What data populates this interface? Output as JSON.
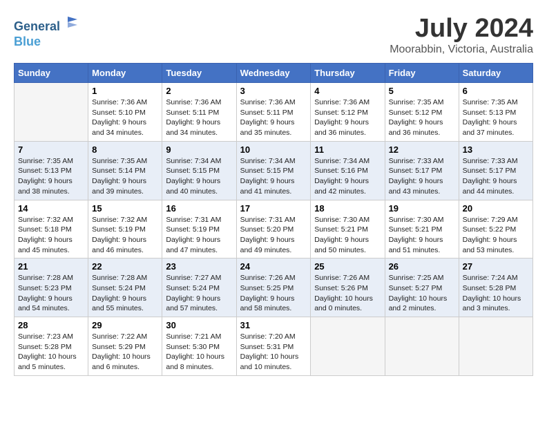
{
  "header": {
    "logo_line1": "General",
    "logo_line2": "Blue",
    "month": "July 2024",
    "location": "Moorabbin, Victoria, Australia"
  },
  "columns": [
    "Sunday",
    "Monday",
    "Tuesday",
    "Wednesday",
    "Thursday",
    "Friday",
    "Saturday"
  ],
  "weeks": [
    [
      {
        "day": "",
        "info": ""
      },
      {
        "day": "1",
        "info": "Sunrise: 7:36 AM\nSunset: 5:10 PM\nDaylight: 9 hours\nand 34 minutes."
      },
      {
        "day": "2",
        "info": "Sunrise: 7:36 AM\nSunset: 5:11 PM\nDaylight: 9 hours\nand 34 minutes."
      },
      {
        "day": "3",
        "info": "Sunrise: 7:36 AM\nSunset: 5:11 PM\nDaylight: 9 hours\nand 35 minutes."
      },
      {
        "day": "4",
        "info": "Sunrise: 7:36 AM\nSunset: 5:12 PM\nDaylight: 9 hours\nand 36 minutes."
      },
      {
        "day": "5",
        "info": "Sunrise: 7:35 AM\nSunset: 5:12 PM\nDaylight: 9 hours\nand 36 minutes."
      },
      {
        "day": "6",
        "info": "Sunrise: 7:35 AM\nSunset: 5:13 PM\nDaylight: 9 hours\nand 37 minutes."
      }
    ],
    [
      {
        "day": "7",
        "info": "Sunrise: 7:35 AM\nSunset: 5:13 PM\nDaylight: 9 hours\nand 38 minutes."
      },
      {
        "day": "8",
        "info": "Sunrise: 7:35 AM\nSunset: 5:14 PM\nDaylight: 9 hours\nand 39 minutes."
      },
      {
        "day": "9",
        "info": "Sunrise: 7:34 AM\nSunset: 5:15 PM\nDaylight: 9 hours\nand 40 minutes."
      },
      {
        "day": "10",
        "info": "Sunrise: 7:34 AM\nSunset: 5:15 PM\nDaylight: 9 hours\nand 41 minutes."
      },
      {
        "day": "11",
        "info": "Sunrise: 7:34 AM\nSunset: 5:16 PM\nDaylight: 9 hours\nand 42 minutes."
      },
      {
        "day": "12",
        "info": "Sunrise: 7:33 AM\nSunset: 5:17 PM\nDaylight: 9 hours\nand 43 minutes."
      },
      {
        "day": "13",
        "info": "Sunrise: 7:33 AM\nSunset: 5:17 PM\nDaylight: 9 hours\nand 44 minutes."
      }
    ],
    [
      {
        "day": "14",
        "info": "Sunrise: 7:32 AM\nSunset: 5:18 PM\nDaylight: 9 hours\nand 45 minutes."
      },
      {
        "day": "15",
        "info": "Sunrise: 7:32 AM\nSunset: 5:19 PM\nDaylight: 9 hours\nand 46 minutes."
      },
      {
        "day": "16",
        "info": "Sunrise: 7:31 AM\nSunset: 5:19 PM\nDaylight: 9 hours\nand 47 minutes."
      },
      {
        "day": "17",
        "info": "Sunrise: 7:31 AM\nSunset: 5:20 PM\nDaylight: 9 hours\nand 49 minutes."
      },
      {
        "day": "18",
        "info": "Sunrise: 7:30 AM\nSunset: 5:21 PM\nDaylight: 9 hours\nand 50 minutes."
      },
      {
        "day": "19",
        "info": "Sunrise: 7:30 AM\nSunset: 5:21 PM\nDaylight: 9 hours\nand 51 minutes."
      },
      {
        "day": "20",
        "info": "Sunrise: 7:29 AM\nSunset: 5:22 PM\nDaylight: 9 hours\nand 53 minutes."
      }
    ],
    [
      {
        "day": "21",
        "info": "Sunrise: 7:28 AM\nSunset: 5:23 PM\nDaylight: 9 hours\nand 54 minutes."
      },
      {
        "day": "22",
        "info": "Sunrise: 7:28 AM\nSunset: 5:24 PM\nDaylight: 9 hours\nand 55 minutes."
      },
      {
        "day": "23",
        "info": "Sunrise: 7:27 AM\nSunset: 5:24 PM\nDaylight: 9 hours\nand 57 minutes."
      },
      {
        "day": "24",
        "info": "Sunrise: 7:26 AM\nSunset: 5:25 PM\nDaylight: 9 hours\nand 58 minutes."
      },
      {
        "day": "25",
        "info": "Sunrise: 7:26 AM\nSunset: 5:26 PM\nDaylight: 10 hours\nand 0 minutes."
      },
      {
        "day": "26",
        "info": "Sunrise: 7:25 AM\nSunset: 5:27 PM\nDaylight: 10 hours\nand 2 minutes."
      },
      {
        "day": "27",
        "info": "Sunrise: 7:24 AM\nSunset: 5:28 PM\nDaylight: 10 hours\nand 3 minutes."
      }
    ],
    [
      {
        "day": "28",
        "info": "Sunrise: 7:23 AM\nSunset: 5:28 PM\nDaylight: 10 hours\nand 5 minutes."
      },
      {
        "day": "29",
        "info": "Sunrise: 7:22 AM\nSunset: 5:29 PM\nDaylight: 10 hours\nand 6 minutes."
      },
      {
        "day": "30",
        "info": "Sunrise: 7:21 AM\nSunset: 5:30 PM\nDaylight: 10 hours\nand 8 minutes."
      },
      {
        "day": "31",
        "info": "Sunrise: 7:20 AM\nSunset: 5:31 PM\nDaylight: 10 hours\nand 10 minutes."
      },
      {
        "day": "",
        "info": ""
      },
      {
        "day": "",
        "info": ""
      },
      {
        "day": "",
        "info": ""
      }
    ]
  ]
}
